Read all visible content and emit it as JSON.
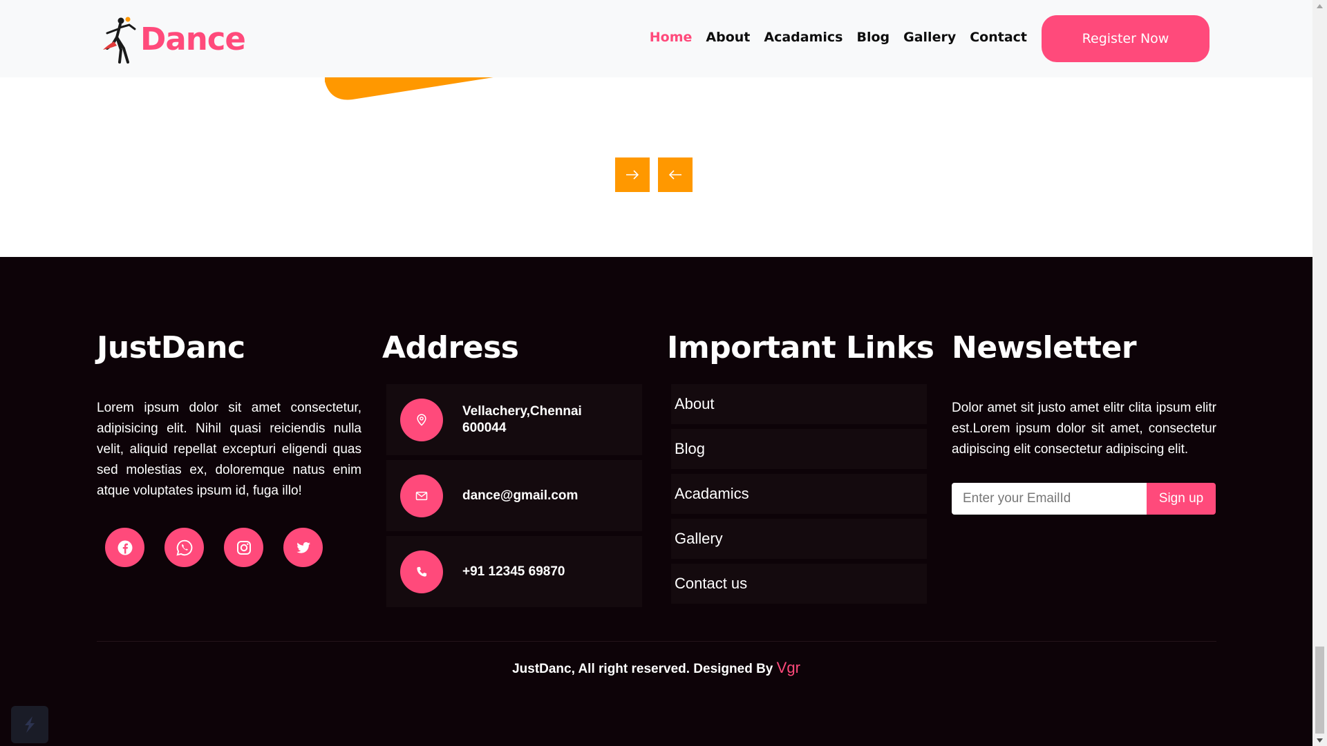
{
  "brand": {
    "name": "Dance"
  },
  "nav": {
    "items": [
      {
        "label": "Home",
        "active": true
      },
      {
        "label": "About",
        "active": false
      },
      {
        "label": "Acadamics",
        "active": false
      },
      {
        "label": "Blog",
        "active": false
      },
      {
        "label": "Gallery",
        "active": false
      },
      {
        "label": "Contact",
        "active": false
      }
    ],
    "cta_label": "Register Now"
  },
  "carousel": {
    "next_icon": "arrow-right-icon",
    "prev_icon": "arrow-left-icon"
  },
  "footer": {
    "about": {
      "title": "JustDanc",
      "text": "Lorem ipsum dolor sit amet consectetur, adipisicing elit. Nihil quasi reiciendis nulla velit, aliquid repellat excepturi eligendi quas sed molestias ex, doloremque natus enim atque voluptates ipsum id, fuga illo!",
      "socials": [
        "facebook-icon",
        "whatsapp-icon",
        "instagram-icon",
        "twitter-icon"
      ]
    },
    "address": {
      "title": "Address",
      "items": [
        {
          "icon": "map-pin-icon",
          "line1": "Vellachery,Chennai",
          "line2": "600044"
        },
        {
          "icon": "mail-icon",
          "line1": "dance@gmail.com"
        },
        {
          "icon": "phone-icon",
          "line1": "+91 12345 69870"
        }
      ]
    },
    "links": {
      "title": "Important Links",
      "items": [
        "About",
        "Blog",
        "Acadamics",
        "Gallery",
        "Contact us"
      ]
    },
    "newsletter": {
      "title": "Newsletter",
      "text": "Dolor amet sit justo amet elitr clita ipsum elitr est.Lorem ipsum dolor sit amet, consectetur adipiscing elit consectetur adipiscing elit.",
      "placeholder": "Enter your EmailId",
      "button_label": "Sign up"
    },
    "copyright": {
      "text": "JustDanc, All right reserved. Designed By",
      "designer": "Vgr"
    }
  },
  "colors": {
    "accent": "#ff4a7b",
    "orange": "#ff9800",
    "footer_bg": "#0d0308",
    "card_bg": "#140a0e",
    "nav_bg": "#f8f9fa"
  }
}
